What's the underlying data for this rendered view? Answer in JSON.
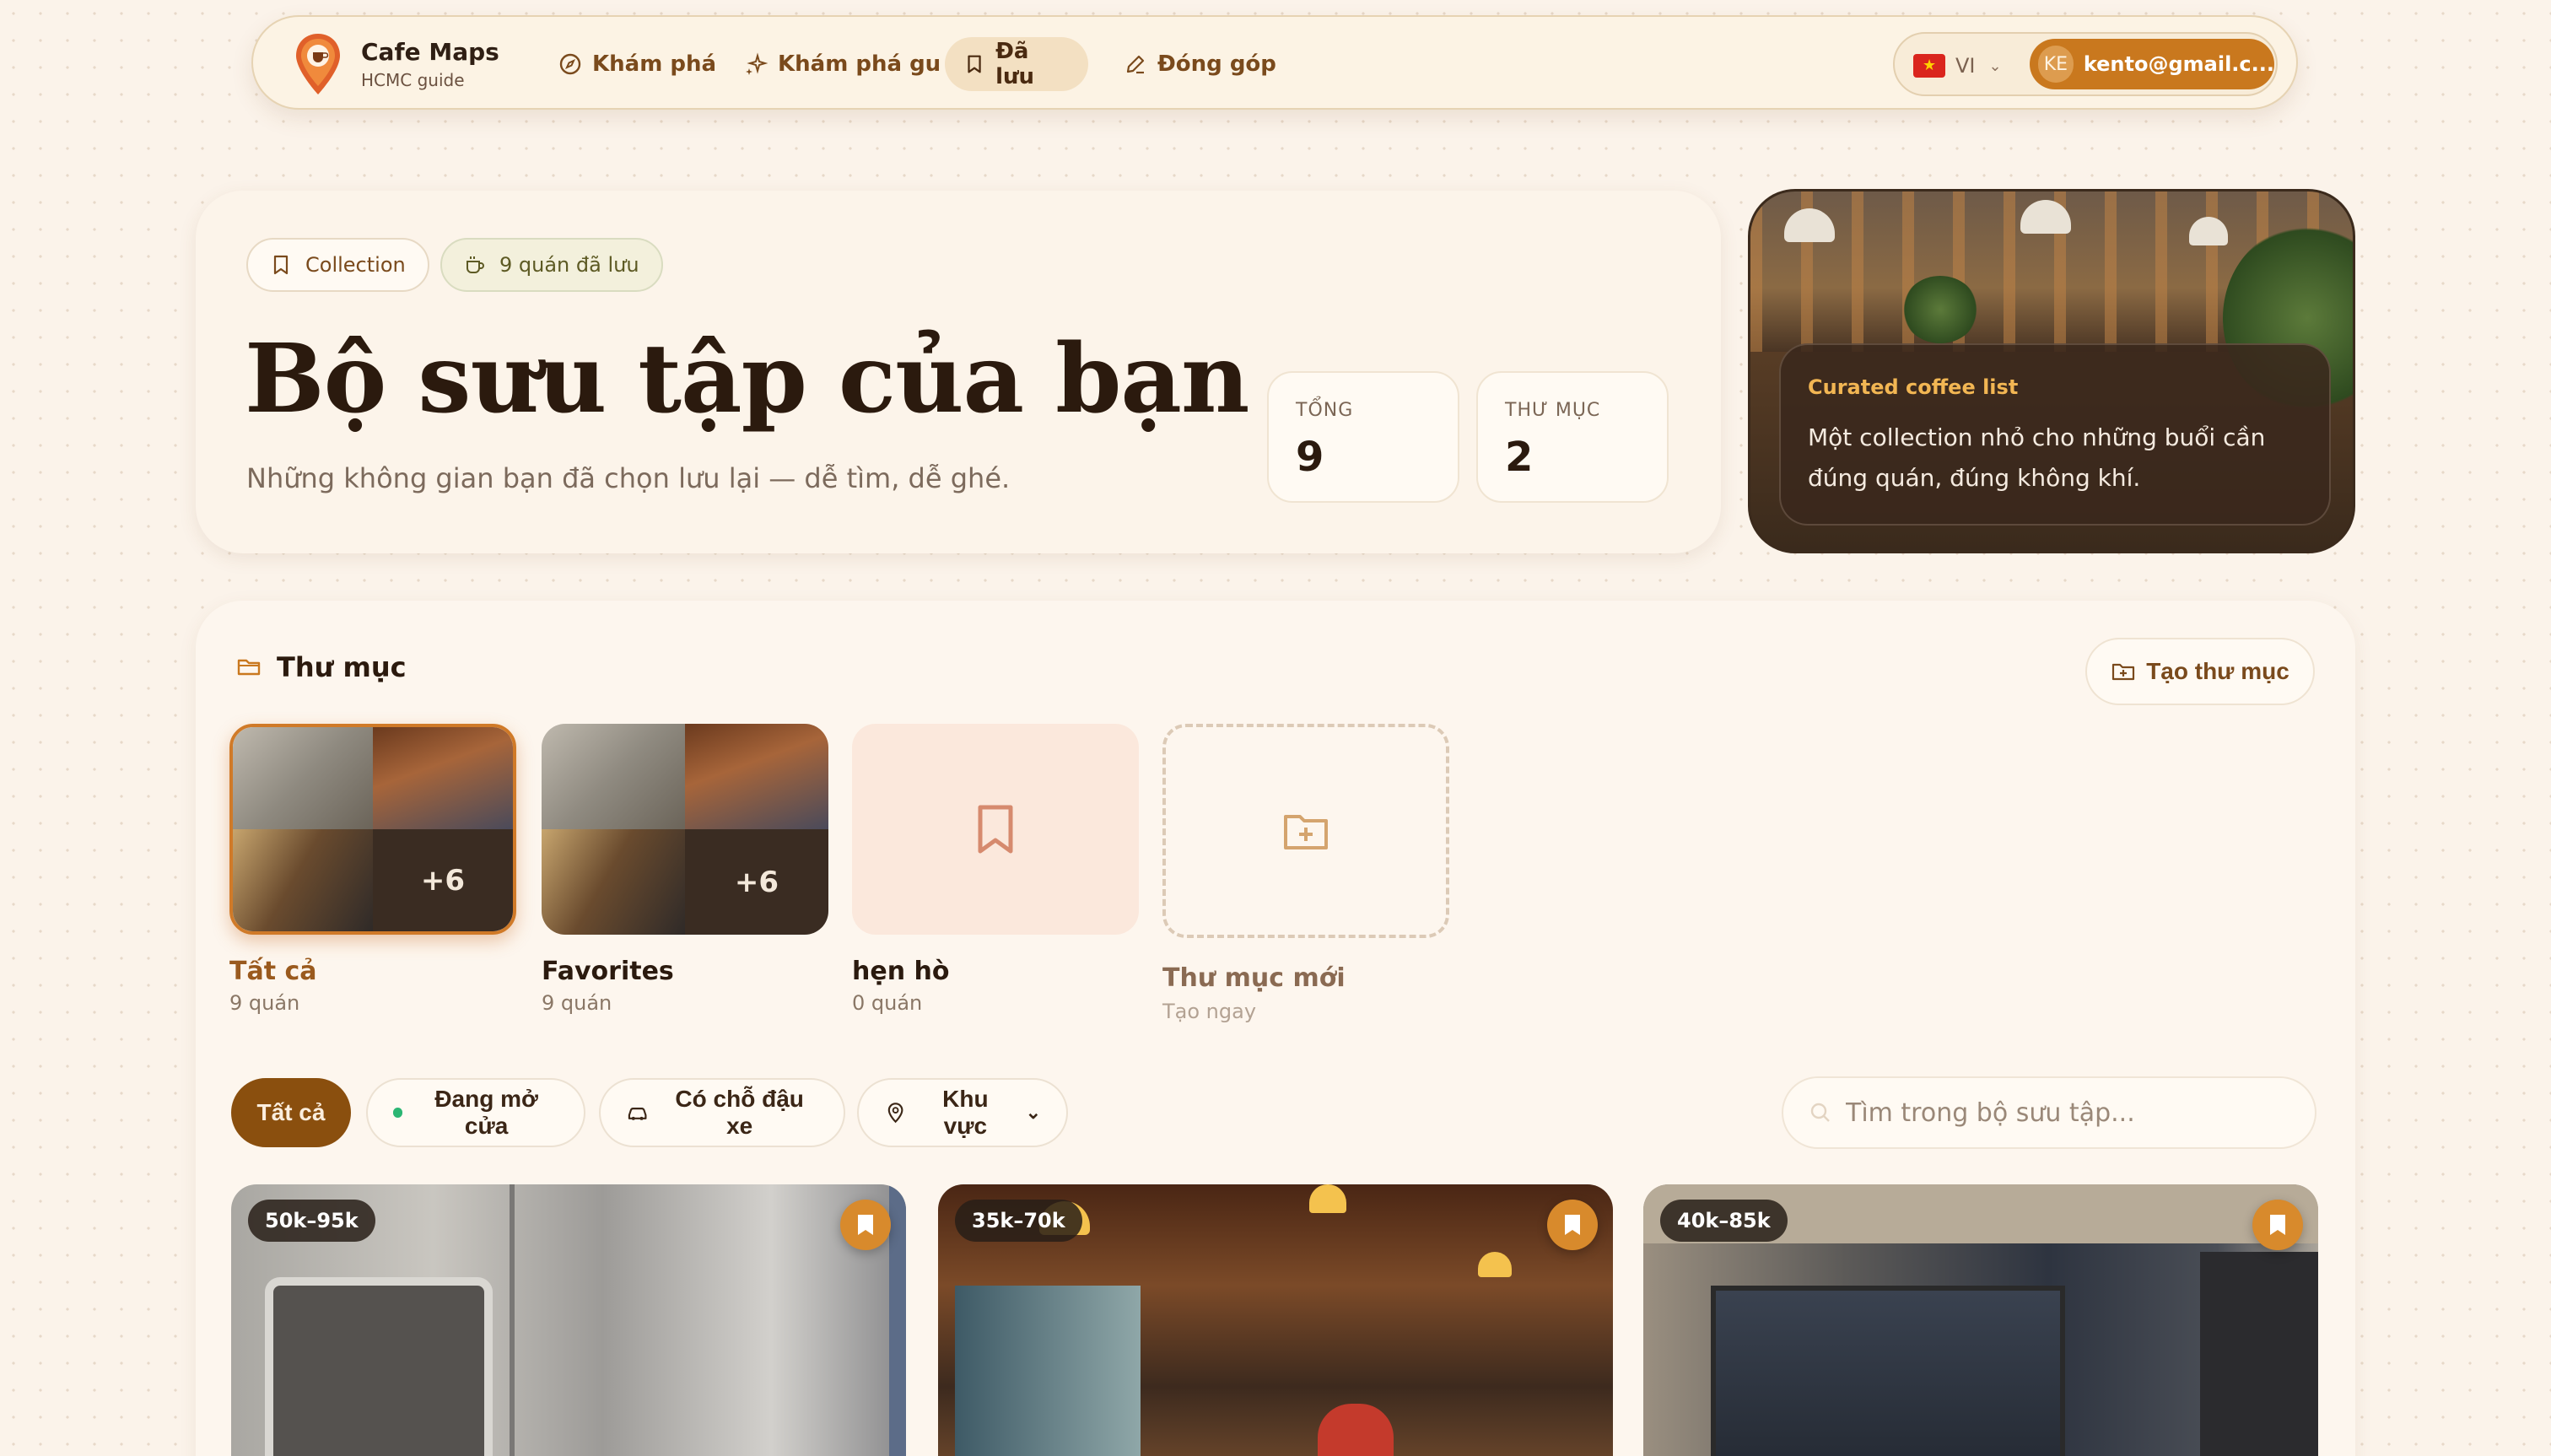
{
  "brand": {
    "title": "Cafe Maps",
    "subtitle": "HCMC guide"
  },
  "nav": {
    "items": [
      {
        "label": "Khám phá",
        "icon": "compass-icon"
      },
      {
        "label": "Khám phá gu",
        "icon": "sparkles-icon"
      },
      {
        "label": "Đã lưu",
        "icon": "bookmark-icon",
        "active": true
      },
      {
        "label": "Đóng góp",
        "icon": "pencil-icon"
      }
    ],
    "language": "VI",
    "user": {
      "initials": "KE",
      "email": "kento@gmail.c..."
    }
  },
  "hero": {
    "chip_collection": "Collection",
    "chip_count": "9 quán đã lưu",
    "title": "Bộ sưu tập của bạn",
    "subtitle": "Những không gian bạn đã chọn lưu lại — dễ tìm, dễ ghé.",
    "stats": [
      {
        "label": "TỔNG",
        "value": "9"
      },
      {
        "label": "THƯ MỤC",
        "value": "2"
      }
    ],
    "card": {
      "title": "Curated coffee list",
      "text": "Một collection nhỏ cho những buổi cần đúng quán, đúng không khí."
    }
  },
  "folders": {
    "title": "Thư mục",
    "create_label": "Tạo thư mục",
    "items": [
      {
        "name": "Tất cả",
        "count": "9 quán",
        "more": "+6"
      },
      {
        "name": "Favorites",
        "count": "9 quán",
        "more": "+6"
      },
      {
        "name": "hẹn hò",
        "count": "0 quán"
      }
    ],
    "new_folder": {
      "name": "Thư mục mới",
      "sub": "Tạo ngay"
    }
  },
  "filters": {
    "all": "Tất cả",
    "open": "Đang mở cửa",
    "parking": "Có chỗ đậu xe",
    "area": "Khu vực",
    "search_placeholder": "Tìm trong bộ sưu tập..."
  },
  "cafes": [
    {
      "price": "50k–95k"
    },
    {
      "price": "35k–70k"
    },
    {
      "price": "40k–85k"
    }
  ],
  "colors": {
    "accent": "#c9781e",
    "active_filter": "#8a4f0e",
    "open_dot": "#2bb673",
    "background": "#fbf3ea"
  }
}
